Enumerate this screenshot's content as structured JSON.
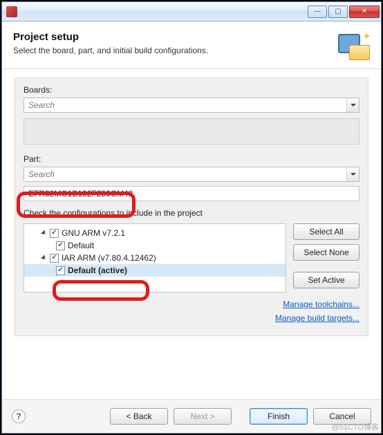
{
  "header": {
    "title": "Project setup",
    "subtitle": "Select the board, part, and initial build configurations."
  },
  "boards": {
    "label": "Boards:",
    "search_placeholder": "Search"
  },
  "part": {
    "label": "Part:",
    "search_placeholder": "Search",
    "selected": "EFR32MG1B132F256GM48"
  },
  "configs": {
    "note": "Check the configurations to include in the project",
    "tree": {
      "gnu": {
        "label": "GNU ARM v7.2.1",
        "child": "Default"
      },
      "iar": {
        "label": "IAR ARM (v7.80.4.12462)",
        "child": "Default (active)"
      }
    },
    "buttons": {
      "select_all": "Select All",
      "select_none": "Select None",
      "set_active": "Set Active"
    },
    "links": {
      "toolchains": "Manage toolchains...",
      "targets": "Manage build targets..."
    }
  },
  "footer": {
    "back": "< Back",
    "next": "Next >",
    "finish": "Finish",
    "cancel": "Cancel"
  },
  "watermark": "@51CTO博客"
}
